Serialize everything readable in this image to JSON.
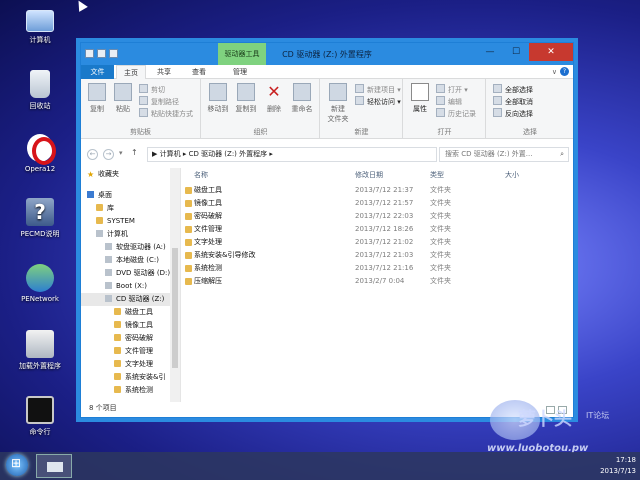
{
  "desktop": {
    "icons": [
      {
        "label": "计算机",
        "icon": "computer-icon"
      },
      {
        "label": "回收站",
        "icon": "recycle-bin-icon"
      },
      {
        "label": "Opera12",
        "icon": "opera-icon"
      },
      {
        "label": "PECMD说明",
        "icon": "help-icon"
      },
      {
        "label": "PENetwork",
        "icon": "network-icon"
      },
      {
        "label": "加载外置程序",
        "icon": "load-program-icon"
      },
      {
        "label": "命令行",
        "icon": "cmd-icon"
      }
    ]
  },
  "window": {
    "title": "CD 驱动器 (Z:) 外置程序",
    "context_tab": "驱动器工具",
    "tabs": [
      "文件",
      "主页",
      "共享",
      "查看",
      "管理"
    ],
    "ribbon": {
      "clipboard": {
        "copy": "复制",
        "paste": "粘贴",
        "cut": "剪切",
        "copy_path": "复制路径",
        "paste_shortcut": "粘贴快捷方式",
        "label": "剪贴板"
      },
      "organize": {
        "move_to": "移动到",
        "copy_to": "复制到",
        "delete": "删除",
        "rename": "重命名",
        "label": "组织"
      },
      "new": {
        "new_folder": "新建\n文件夹",
        "new_item": "新建项目 ▾",
        "easy_access": "轻松访问 ▾",
        "label": "新建"
      },
      "open": {
        "properties": "属性",
        "open": "打开 ▾",
        "edit": "编辑",
        "history": "历史记录",
        "label": "打开"
      },
      "select": {
        "select_all": "全部选择",
        "select_none": "全部取消",
        "invert": "反向选择",
        "label": "选择"
      }
    },
    "address": {
      "path": "▶  计算机  ▸  CD 驱动器 (Z:) 外置程序  ▸",
      "search_placeholder": "搜索 CD 驱动器 (Z:) 外置..."
    },
    "nav": [
      {
        "label": "收藏夹",
        "icon": "star",
        "indent": 0
      },
      {
        "label": "桌面",
        "icon": "desk",
        "indent": 0
      },
      {
        "label": "库",
        "icon": "folder",
        "indent": 1
      },
      {
        "label": "SYSTEM",
        "icon": "folder",
        "indent": 1
      },
      {
        "label": "计算机",
        "icon": "drive",
        "indent": 1
      },
      {
        "label": "软盘驱动器 (A:)",
        "icon": "drive",
        "indent": 2
      },
      {
        "label": "本地磁盘 (C:)",
        "icon": "drive",
        "indent": 2
      },
      {
        "label": "DVD 驱动器 (D:)",
        "icon": "drive",
        "indent": 2
      },
      {
        "label": "Boot (X:)",
        "icon": "drive",
        "indent": 2
      },
      {
        "label": "CD 驱动器 (Z:)",
        "icon": "drive",
        "indent": 2,
        "selected": true
      },
      {
        "label": "磁盘工具",
        "icon": "folder",
        "indent": 3
      },
      {
        "label": "镜像工具",
        "icon": "folder",
        "indent": 3
      },
      {
        "label": "密码破解",
        "icon": "folder",
        "indent": 3
      },
      {
        "label": "文件管理",
        "icon": "folder",
        "indent": 3
      },
      {
        "label": "文字处理",
        "icon": "folder",
        "indent": 3
      },
      {
        "label": "系统安装&引",
        "icon": "folder",
        "indent": 3
      },
      {
        "label": "系统检测",
        "icon": "folder",
        "indent": 3
      }
    ],
    "columns": {
      "name": "名称",
      "date": "修改日期",
      "type": "类型",
      "size": "大小"
    },
    "files": [
      {
        "name": "磁盘工具",
        "date": "2013/7/12 21:37",
        "type": "文件夹"
      },
      {
        "name": "镜像工具",
        "date": "2013/7/12 21:57",
        "type": "文件夹"
      },
      {
        "name": "密码破解",
        "date": "2013/7/12 22:03",
        "type": "文件夹"
      },
      {
        "name": "文件管理",
        "date": "2013/7/12 18:26",
        "type": "文件夹"
      },
      {
        "name": "文字处理",
        "date": "2013/7/12 21:02",
        "type": "文件夹"
      },
      {
        "name": "系统安装&引导修改",
        "date": "2013/7/12 21:03",
        "type": "文件夹"
      },
      {
        "name": "系统检测",
        "date": "2013/7/12 21:16",
        "type": "文件夹"
      },
      {
        "name": "压缩解压",
        "date": "2013/2/7 0:04",
        "type": "文件夹"
      }
    ],
    "status": "8 个项目"
  },
  "taskbar": {
    "time": "17:18",
    "date": "2013/7/13"
  },
  "watermark": {
    "site": "www.luobotou.pw",
    "brand": "萝卜头",
    "forum": "IT论坛"
  }
}
